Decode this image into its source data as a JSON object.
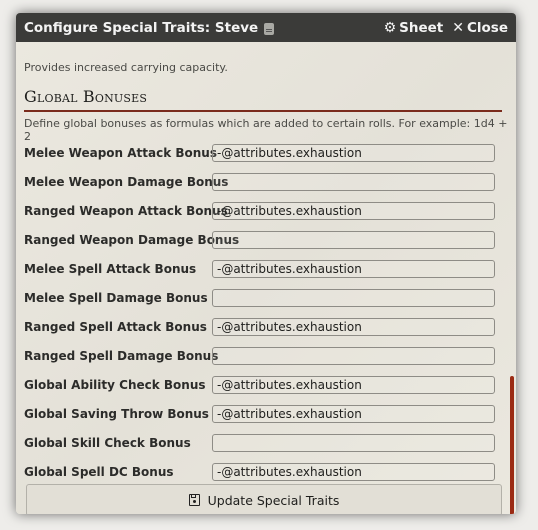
{
  "window": {
    "title": "Configure Special Traits: Steve",
    "sheet_label": "Sheet",
    "close_label": "Close"
  },
  "hint_top": "Provides increased carrying capacity.",
  "section": {
    "title": "Global Bonuses",
    "description": "Define global bonuses as formulas which are added to certain rolls. For example: 1d4 + 2"
  },
  "fields": [
    {
      "label": "Melee Weapon Attack Bonus",
      "value": "-@attributes.exhaustion"
    },
    {
      "label": "Melee Weapon Damage Bonus",
      "value": ""
    },
    {
      "label": "Ranged Weapon Attack Bonus",
      "value": "-@attributes.exhaustion"
    },
    {
      "label": "Ranged Weapon Damage Bonus",
      "value": ""
    },
    {
      "label": "Melee Spell Attack Bonus",
      "value": "-@attributes.exhaustion"
    },
    {
      "label": "Melee Spell Damage Bonus",
      "value": ""
    },
    {
      "label": "Ranged Spell Attack Bonus",
      "value": "-@attributes.exhaustion"
    },
    {
      "label": "Ranged Spell Damage Bonus",
      "value": ""
    },
    {
      "label": "Global Ability Check Bonus",
      "value": "-@attributes.exhaustion"
    },
    {
      "label": "Global Saving Throw Bonus",
      "value": "-@attributes.exhaustion"
    },
    {
      "label": "Global Skill Check Bonus",
      "value": ""
    },
    {
      "label": "Global Spell DC Bonus",
      "value": "-@attributes.exhaustion"
    }
  ],
  "submit_label": "Update Special Traits",
  "colors": {
    "titlebar": "#3b3b39",
    "accent_rule": "#7a2b1c",
    "scrollbar": "#9b2b14"
  },
  "icons": {
    "header_title": "id-card-icon",
    "sheet": "gear-icon",
    "close": "close-icon",
    "submit": "save-icon"
  }
}
